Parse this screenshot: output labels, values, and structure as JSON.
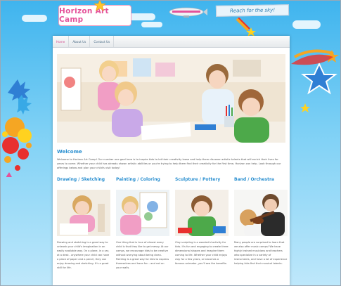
{
  "site": {
    "logo_text": "Horizon Art Camp",
    "tagline": "Reach for the sky!"
  },
  "nav": {
    "items": [
      {
        "label": "Home",
        "active": true
      },
      {
        "label": "About Us",
        "active": false
      },
      {
        "label": "Contact Us",
        "active": false
      }
    ]
  },
  "welcome": {
    "title": "Welcome",
    "text": "Welcome to Horizon Art Camp! Our number one goal here is to inspire kids to let their creativity loose and help them discover artistic talents that will enrich their lives for years to come. Whether your child has already shown artistic abilities or you're trying to help them find their creativity for the first time, Horizon can help. Look through our offerings below and plan your child's visit today!"
  },
  "programs": [
    {
      "title": "Drawing / Sketching",
      "text": "Drawing and sketching is a great way to unleash your child's imagination in an easily available way. On a plane, in a car, at a desk - anywhere your child can have a piece of paper and a pencil, they can enjoy drawing and sketching. It's a great skill for life."
    },
    {
      "title": "Painting / Coloring",
      "text": "One thing that is true of almost every child is that they like to get messy. At our camps, we encourage kids to be creative without worrying about being clean. Painting is a great way for kids to express themselves and have fun - and not on your walls."
    },
    {
      "title": "Sculpture / Pottery",
      "text": "Clay sculpting is a wonderful activity for kids. It's fun and engaging to create three dimensional shapes and imagine them coming to life. Whether your child enjoys clay for a few years, or becomes a famous animator, you'll see the benefits."
    },
    {
      "title": "Band / Orchestra",
      "text": "Many people are surprised to learn that we also offer music camps! We have highly trained musicians and teachers who specialize in a variety of instruments, and have a lot of experience helping kids find their musical talents."
    }
  ],
  "colors": {
    "accent_pink": "#e4529a",
    "accent_blue": "#2a8fd0",
    "sky": "#3fb4ee"
  }
}
